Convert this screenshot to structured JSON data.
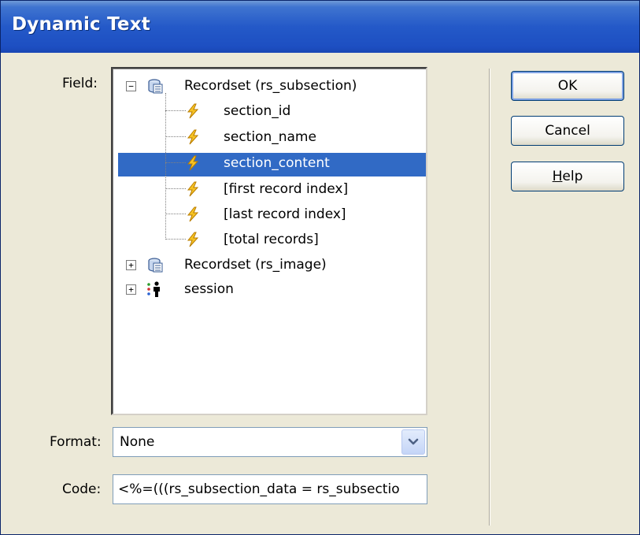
{
  "window": {
    "title": "Dynamic Text"
  },
  "labels": {
    "field": "Field:",
    "format": "Format:",
    "code": "Code:"
  },
  "tree": {
    "nodes": [
      {
        "label": "Recordset (rs_subsection)",
        "type": "recordset",
        "expander": "−",
        "expanded": true,
        "children": [
          {
            "label": "section_id"
          },
          {
            "label": "section_name"
          },
          {
            "label": "section_content",
            "selected": true
          },
          {
            "label": "[first record index]"
          },
          {
            "label": "[last record index]"
          },
          {
            "label": "[total records]"
          }
        ]
      },
      {
        "label": "Recordset (rs_image)",
        "type": "recordset",
        "expander": "+",
        "expanded": false
      },
      {
        "label": "session",
        "type": "session",
        "expander": "+",
        "expanded": false
      }
    ]
  },
  "format": {
    "value": "None"
  },
  "code": {
    "value": "<%=(((rs_subsection_data = rs_subsectio"
  },
  "buttons": {
    "ok": "OK",
    "cancel": "Cancel",
    "help_first": "H",
    "help_rest": "elp"
  },
  "colors": {
    "title_bar": "#2459c8",
    "selection": "#316ac5",
    "dialog_bg": "#ece9d8"
  }
}
